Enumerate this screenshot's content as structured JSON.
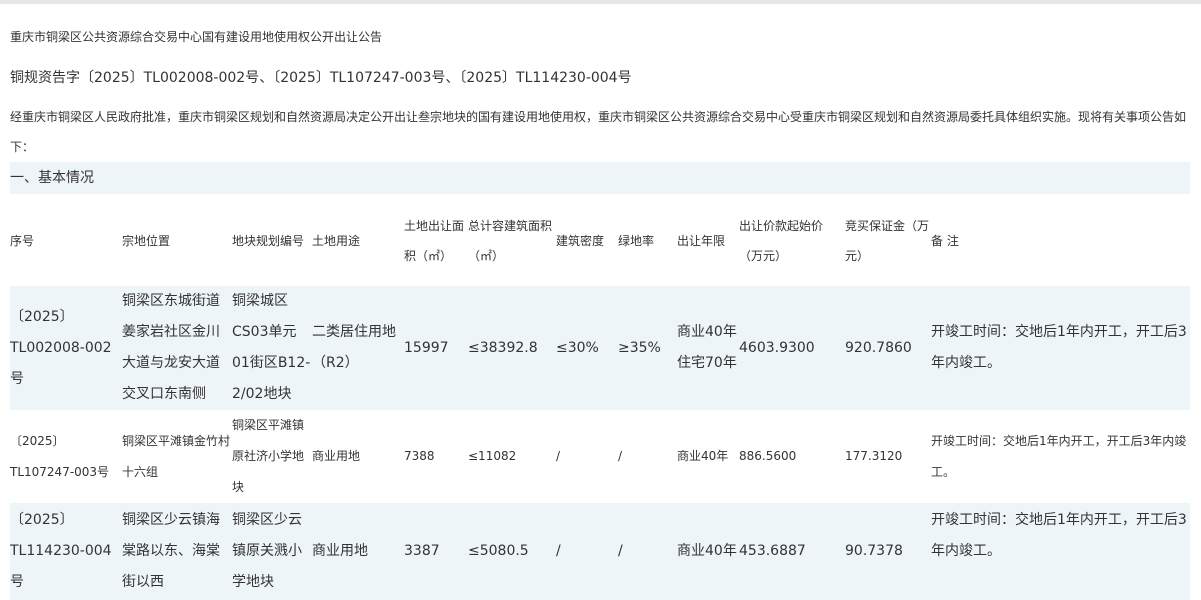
{
  "header": {
    "title": "重庆市铜梁区公共资源综合交易中心国有建设用地使用权公开出让公告",
    "doc_no": "铜规资告字〔2025〕TL002008-002号、〔2025〕TL107247-003号、〔2025〕TL114230-004号",
    "intro": "经重庆市铜梁区人民政府批准，重庆市铜梁区规划和自然资源局决定公开出让叁宗地块的国有建设用地使用权，重庆市铜梁区公共资源综合交易中心受重庆市铜梁区规划和自然资源局委托具体组织实施。现将有关事项公告如下：",
    "section": "一、基本情况"
  },
  "table": {
    "headers": {
      "no": "序号",
      "location": "宗地位置",
      "plan_code": "地块规划编号",
      "land_use": "土地用途",
      "area": "土地出让面积（㎡）",
      "gfa": "总计容建筑面积（㎡）",
      "density": "建筑密度",
      "green": "绿地率",
      "term": "出让年限",
      "start_price": "出让价款起始价（万元）",
      "deposit": "竞买保证金（万元）",
      "remark": "备 注"
    },
    "rows": [
      {
        "no": "〔2025〕TL002008-002号",
        "location": "铜梁区东城街道姜家岩社区金川大道与龙安大道交叉口东南侧",
        "plan_code": "铜梁城区CS03单元01街区B12-2/02地块",
        "land_use": "二类居住用地（R2）",
        "area": "15997",
        "gfa": "≤38392.8",
        "density": "≤30%",
        "green": "≥35%",
        "term": "商业40年住宅70年",
        "start_price": "4603.9300",
        "deposit": "920.7860",
        "remark": "开竣工时间：交地后1年内开工，开工后3年内竣工。"
      },
      {
        "no": "〔2025〕TL107247-003号",
        "location": "铜梁区平滩镇金竹村十六组",
        "plan_code": "铜梁区平滩镇原社济小学地块",
        "land_use": "商业用地",
        "area": "7388",
        "gfa": "≤11082",
        "density": "/",
        "green": "/",
        "term": "商业40年",
        "start_price": "886.5600",
        "deposit": "177.3120",
        "remark": "开竣工时间：交地后1年内开工，开工后3年内竣工。"
      },
      {
        "no": "〔2025〕TL114230-004号",
        "location": "铜梁区少云镇海棠路以东、海棠街以西",
        "plan_code": "铜梁区少云镇原关溅小学地块",
        "land_use": "商业用地",
        "area": "3387",
        "gfa": "≤5080.5",
        "density": "/",
        "green": "/",
        "term": "商业40年",
        "start_price": "453.6887",
        "deposit": "90.7378",
        "remark": "开竣工时间：交地后1年内开工，开工后3年内竣工。"
      }
    ]
  }
}
